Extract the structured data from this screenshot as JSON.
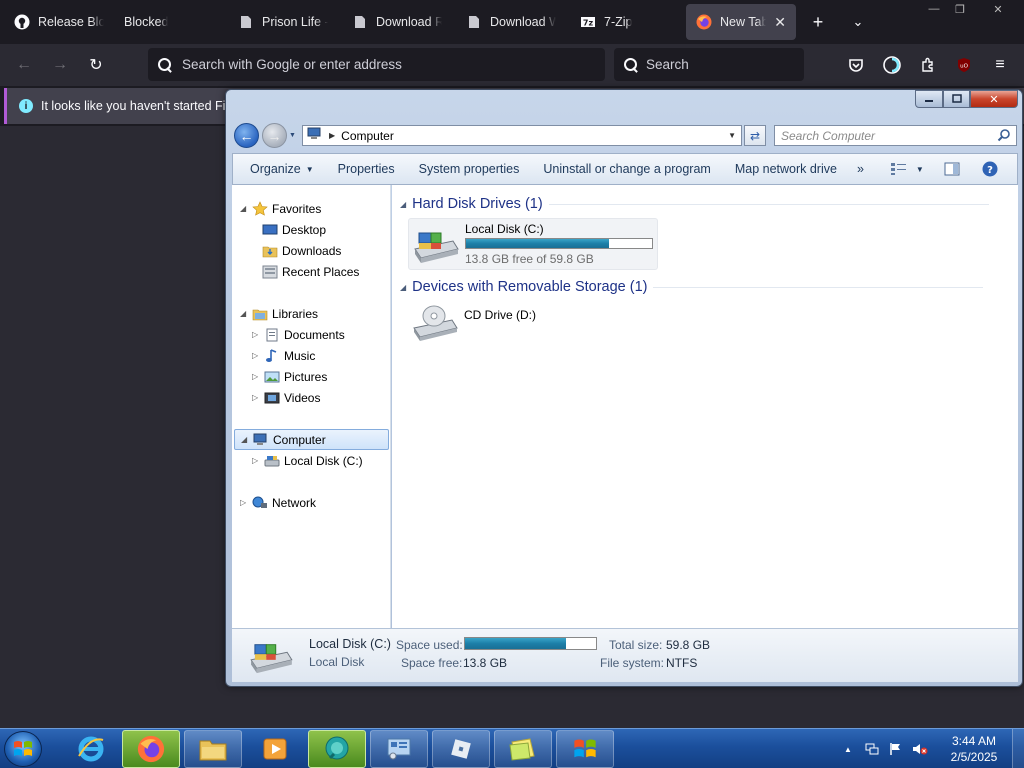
{
  "firefox": {
    "tabs": [
      {
        "title": "Release Blox",
        "icon": "github-icon"
      },
      {
        "title": "Blocked",
        "icon": "blank-page-icon"
      },
      {
        "title": "Prison Life - f",
        "icon": "page-icon"
      },
      {
        "title": "Download Ro",
        "icon": "page-icon"
      },
      {
        "title": "Download W",
        "icon": "page-icon"
      },
      {
        "title": "7-Zip",
        "icon": "7zip-icon"
      },
      {
        "title": "New Tab",
        "icon": "firefox-icon"
      }
    ],
    "url_placeholder": "Search with Google or enter address",
    "search_placeholder": "Search",
    "notification": "It looks like you haven't started Firefox in a while. Do you want to clean it up for a fresh, like-new experience? And by the way, welcome back!"
  },
  "explorer": {
    "address": "Computer",
    "search_placeholder": "Search Computer",
    "commands": [
      "Organize",
      "Properties",
      "System properties",
      "Uninstall or change a program",
      "Map network drive",
      "»"
    ],
    "nav": {
      "favorites": "Favorites",
      "desktop": "Desktop",
      "downloads": "Downloads",
      "recent_places": "Recent Places",
      "libraries": "Libraries",
      "documents": "Documents",
      "music": "Music",
      "pictures": "Pictures",
      "videos": "Videos",
      "computer": "Computer",
      "local_disk": "Local Disk (C:)",
      "network": "Network"
    },
    "groups": {
      "hdd_header": "Hard Disk Drives (1)",
      "removable_header": "Devices with Removable Storage (1)"
    },
    "local_disk": {
      "name": "Local Disk (C:)",
      "free_text": "13.8 GB free of 59.8 GB",
      "used_fraction": 0.77
    },
    "cd_drive": {
      "name": "CD Drive (D:)"
    },
    "details": {
      "title": "Local Disk (C:)",
      "subtitle": "Local Disk",
      "space_used_label": "Space used:",
      "space_free_label": "Space free:",
      "space_free": "13.8 GB",
      "total_size_label": "Total size:",
      "total_size": "59.8 GB",
      "file_system_label": "File system:",
      "file_system": "NTFS"
    }
  },
  "taskbar": {
    "time": "3:44 AM",
    "date": "2/5/2025"
  },
  "colors": {
    "firefox_bg": "#1c1b22",
    "firefox_toolbar": "#2b2a33",
    "explorer_header": "#1e3287",
    "usage_fill": "#1d7fa8",
    "taskbar": "#1b4f9c"
  }
}
